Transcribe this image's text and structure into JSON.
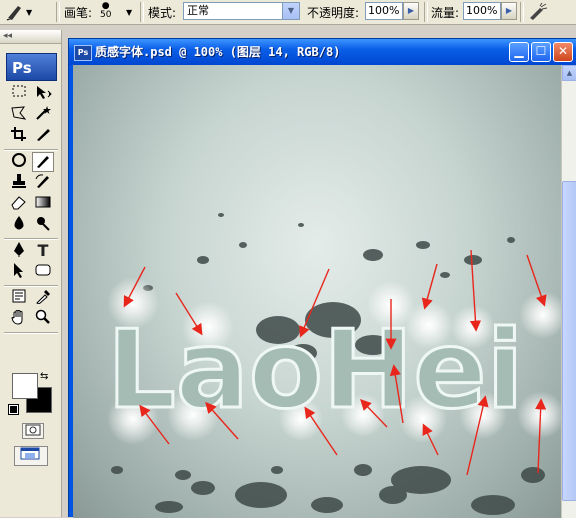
{
  "options_bar": {
    "brush_label": "画笔:",
    "brush_size": "50",
    "mode_label": "模式:",
    "mode_value": "正常",
    "opacity_label": "不透明度:",
    "opacity_value": "100%",
    "flow_label": "流量:",
    "flow_value": "100%",
    "icons": [
      "brush-tool-icon",
      "airbrush-icon"
    ]
  },
  "toolbox": {
    "logo": "Ps",
    "grip": "◂◂",
    "foreground_color": "#ffffff",
    "background_color": "#000000",
    "type_tool_glyph": "T"
  },
  "document": {
    "title": "质感字体.psd @ 100% (图层 14, RGB/8)",
    "artwork_text": "LaoHei",
    "colors": {
      "titlebar": "#0054e3",
      "canvas": "#c6d4d0",
      "splatter": "#3e4a48",
      "arrow": "#e8261c",
      "glow": "#ffffff"
    }
  }
}
